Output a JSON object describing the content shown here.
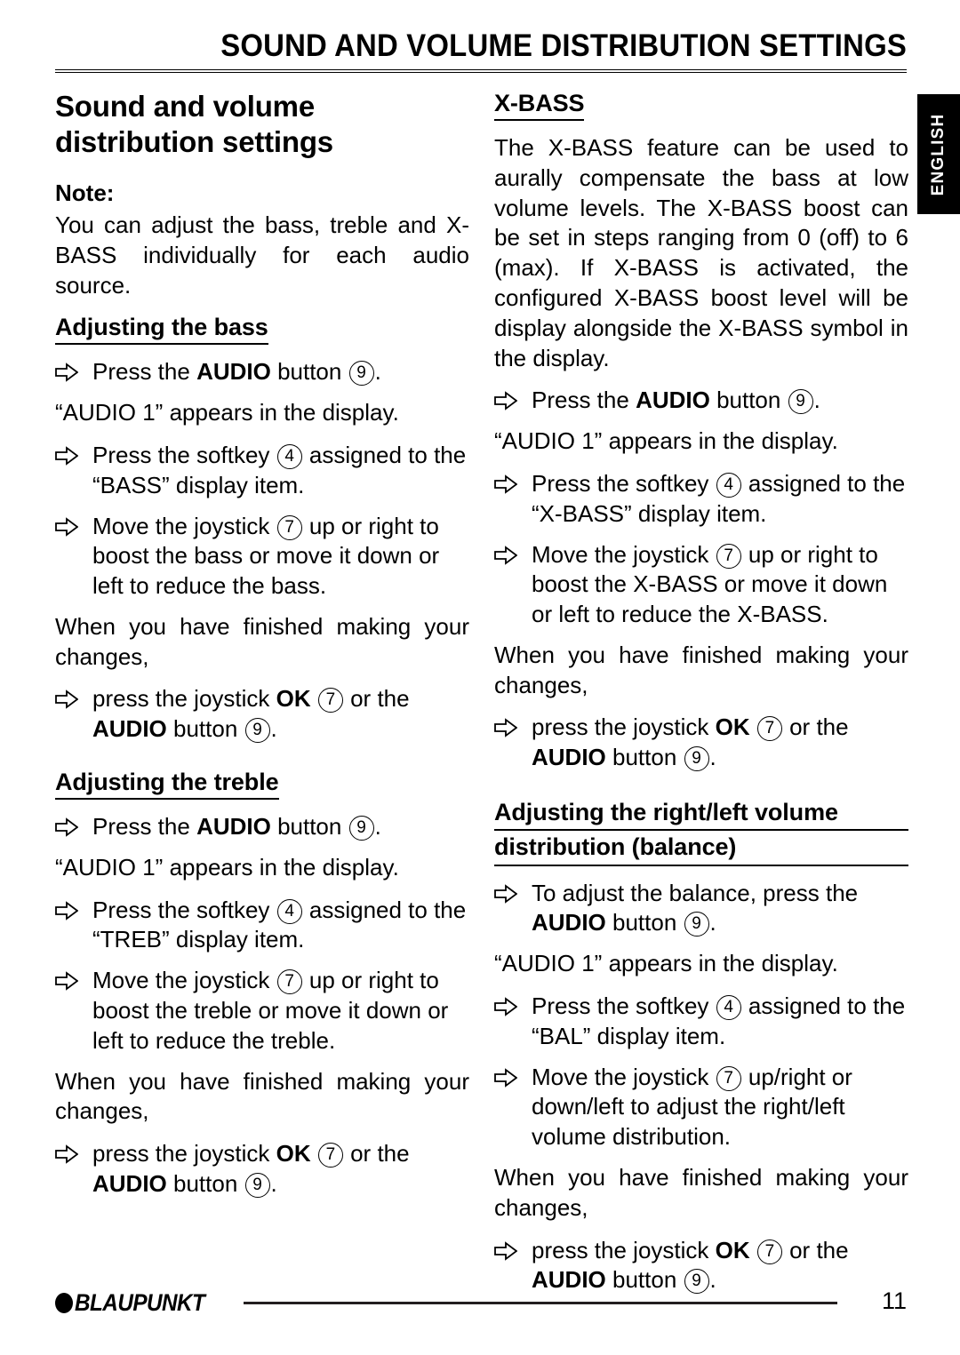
{
  "header": {
    "running_title": "SOUND AND VOLUME DISTRIBUTION SETTINGS",
    "language_tab": "ENGLISH"
  },
  "left_column": {
    "title": "Sound and volume distribution settings",
    "note_label": "Note:",
    "note_text": "You can adjust the bass, treble and X-BASS individually for each audio source.",
    "section_bass": {
      "heading": "Adjusting the bass",
      "step1_a": "Press the ",
      "step1_b": "AUDIO",
      "step1_c": " button ",
      "step1_ref": "9",
      "step1_d": ".",
      "result1": "“AUDIO 1” appears in the display.",
      "step2_a": "Press the softkey ",
      "step2_ref": "4",
      "step2_b": " assigned to the “BASS” display item.",
      "step3_a": "Move the joystick ",
      "step3_ref": "7",
      "step3_b": " up or right to boost the bass or move it down or left to reduce the bass.",
      "closing": "When you have finished making your changes,",
      "step4_a": "press the joystick ",
      "step4_ok": "OK",
      "step4_ref1": "7",
      "step4_b": " or the ",
      "step4_audio": "AUDIO",
      "step4_c": " button ",
      "step4_ref2": "9",
      "step4_d": "."
    },
    "section_treble": {
      "heading": "Adjusting the treble",
      "step1_a": "Press the ",
      "step1_b": "AUDIO",
      "step1_c": " button ",
      "step1_ref": "9",
      "step1_d": ".",
      "result1": "“AUDIO 1” appears in the display.",
      "step2_a": "Press the softkey ",
      "step2_ref": "4",
      "step2_b": " assigned to the “TREB” display item.",
      "step3_a": "Move the joystick ",
      "step3_ref": "7",
      "step3_b": " up or right to boost the treble or move it down or left to reduce the treble.",
      "closing": "When you have finished making your changes,",
      "step4_a": "press the joystick ",
      "step4_ok": "OK",
      "step4_ref1": "7",
      "step4_b": " or the ",
      "step4_audio": "AUDIO",
      "step4_c": " button ",
      "step4_ref2": "9",
      "step4_d": "."
    }
  },
  "right_column": {
    "section_xbass": {
      "heading": "X-BASS",
      "intro": "The X-BASS feature can be used to aurally compensate the bass at low volume levels. The X-BASS boost can be set in steps ranging from 0 (off) to 6 (max). If X-BASS is activated, the configured X-BASS boost level will be display alongside the X-BASS symbol in the display.",
      "step1_a": "Press the ",
      "step1_b": "AUDIO",
      "step1_c": " button ",
      "step1_ref": "9",
      "step1_d": ".",
      "result1": "“AUDIO 1” appears in the display.",
      "step2_a": "Press the softkey ",
      "step2_ref": "4",
      "step2_b": " assigned to the “X-BASS” display item.",
      "step3_a": "Move the joystick ",
      "step3_ref": "7",
      "step3_b": " up or right to boost the X-BASS or move it down or left to reduce the X-BASS.",
      "closing": "When you have finished making your changes,",
      "step4_a": "press the joystick ",
      "step4_ok": "OK",
      "step4_ref1": "7",
      "step4_b": " or the ",
      "step4_audio": "AUDIO",
      "step4_c": " button ",
      "step4_ref2": "9",
      "step4_d": "."
    },
    "section_balance": {
      "heading_line1": "Adjusting the right/left volume",
      "heading_line2": "distribution (balance)",
      "step1_a": "To adjust the balance, press the ",
      "step1_b": "AUDIO",
      "step1_c": " button ",
      "step1_ref": "9",
      "step1_d": ".",
      "result1": "“AUDIO 1” appears in the display.",
      "step2_a": "Press the softkey ",
      "step2_ref": "4",
      "step2_b": " assigned to the “BAL” display item.",
      "step3_a": "Move the joystick ",
      "step3_ref": "7",
      "step3_b": " up/right or down/left to adjust the right/left volume distribution.",
      "closing": "When you have finished making your changes,",
      "step4_a": "press the joystick ",
      "step4_ok": "OK",
      "step4_ref1": "7",
      "step4_b": " or the ",
      "step4_audio": "AUDIO",
      "step4_c": " button ",
      "step4_ref2": "9",
      "step4_d": "."
    }
  },
  "footer": {
    "brand": "BLAUPUNKT",
    "page_number": "11"
  },
  "colors": {
    "ink": "#000000",
    "paper": "#ffffff",
    "rule": "#231f20"
  }
}
